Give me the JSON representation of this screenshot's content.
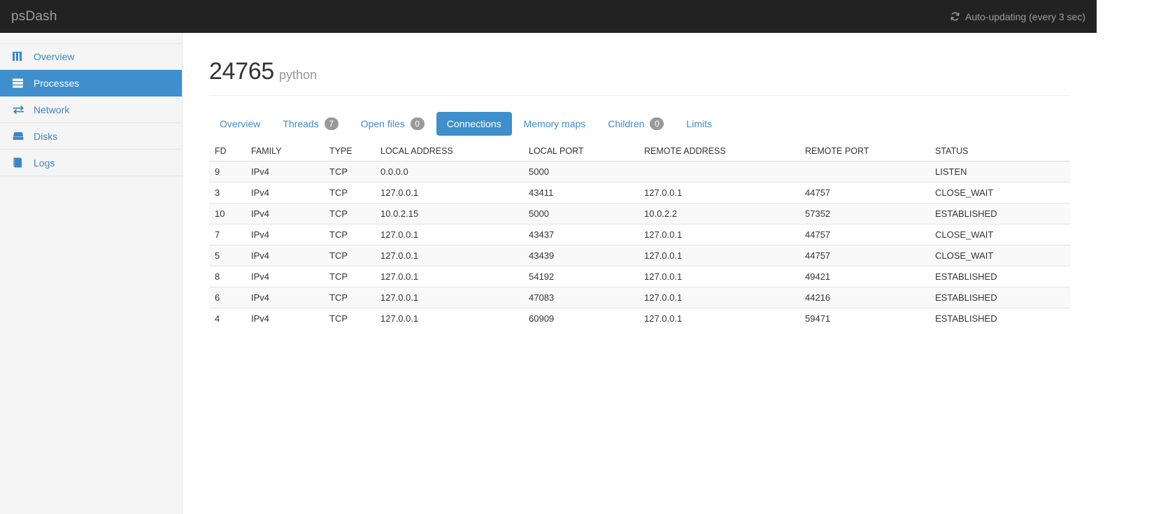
{
  "navbar": {
    "brand": "psDash",
    "auto_update_text": "Auto-updating (every 3 sec)",
    "refresh_icon": "refresh-icon",
    "background": "#222222",
    "text_color": "#9d9d9d"
  },
  "sidebar": {
    "accent": "#3e8fcc",
    "items": [
      {
        "label": "Overview",
        "icon": "dashboard-icon",
        "active": false
      },
      {
        "label": "Processes",
        "icon": "server-list-icon",
        "active": true
      },
      {
        "label": "Network",
        "icon": "exchange-arrows-icon",
        "active": false
      },
      {
        "label": "Disks",
        "icon": "hdd-icon",
        "active": false
      },
      {
        "label": "Logs",
        "icon": "book-icon",
        "active": false
      }
    ]
  },
  "page": {
    "pid": "24765",
    "process_name": "python"
  },
  "tabs": [
    {
      "label": "Overview",
      "badge": null,
      "active": false
    },
    {
      "label": "Threads",
      "badge": "7",
      "active": false
    },
    {
      "label": "Open files",
      "badge": "0",
      "active": false
    },
    {
      "label": "Connections",
      "badge": null,
      "active": true
    },
    {
      "label": "Memory maps",
      "badge": null,
      "active": false
    },
    {
      "label": "Children",
      "badge": "0",
      "active": false
    },
    {
      "label": "Limits",
      "badge": null,
      "active": false
    }
  ],
  "table": {
    "columns": [
      "FD",
      "FAMILY",
      "TYPE",
      "LOCAL ADDRESS",
      "LOCAL PORT",
      "REMOTE ADDRESS",
      "REMOTE PORT",
      "STATUS"
    ],
    "rows": [
      {
        "fd": "9",
        "family": "IPv4",
        "type": "TCP",
        "local_address": "0.0.0.0",
        "local_port": "5000",
        "remote_address": "",
        "remote_port": "",
        "status": "LISTEN"
      },
      {
        "fd": "3",
        "family": "IPv4",
        "type": "TCP",
        "local_address": "127.0.0.1",
        "local_port": "43411",
        "remote_address": "127.0.0.1",
        "remote_port": "44757",
        "status": "CLOSE_WAIT"
      },
      {
        "fd": "10",
        "family": "IPv4",
        "type": "TCP",
        "local_address": "10.0.2.15",
        "local_port": "5000",
        "remote_address": "10.0.2.2",
        "remote_port": "57352",
        "status": "ESTABLISHED"
      },
      {
        "fd": "7",
        "family": "IPv4",
        "type": "TCP",
        "local_address": "127.0.0.1",
        "local_port": "43437",
        "remote_address": "127.0.0.1",
        "remote_port": "44757",
        "status": "CLOSE_WAIT"
      },
      {
        "fd": "5",
        "family": "IPv4",
        "type": "TCP",
        "local_address": "127.0.0.1",
        "local_port": "43439",
        "remote_address": "127.0.0.1",
        "remote_port": "44757",
        "status": "CLOSE_WAIT"
      },
      {
        "fd": "8",
        "family": "IPv4",
        "type": "TCP",
        "local_address": "127.0.0.1",
        "local_port": "54192",
        "remote_address": "127.0.0.1",
        "remote_port": "49421",
        "status": "ESTABLISHED"
      },
      {
        "fd": "6",
        "family": "IPv4",
        "type": "TCP",
        "local_address": "127.0.0.1",
        "local_port": "47083",
        "remote_address": "127.0.0.1",
        "remote_port": "44216",
        "status": "ESTABLISHED"
      },
      {
        "fd": "4",
        "family": "IPv4",
        "type": "TCP",
        "local_address": "127.0.0.1",
        "local_port": "60909",
        "remote_address": "127.0.0.1",
        "remote_port": "59471",
        "status": "ESTABLISHED"
      }
    ]
  }
}
